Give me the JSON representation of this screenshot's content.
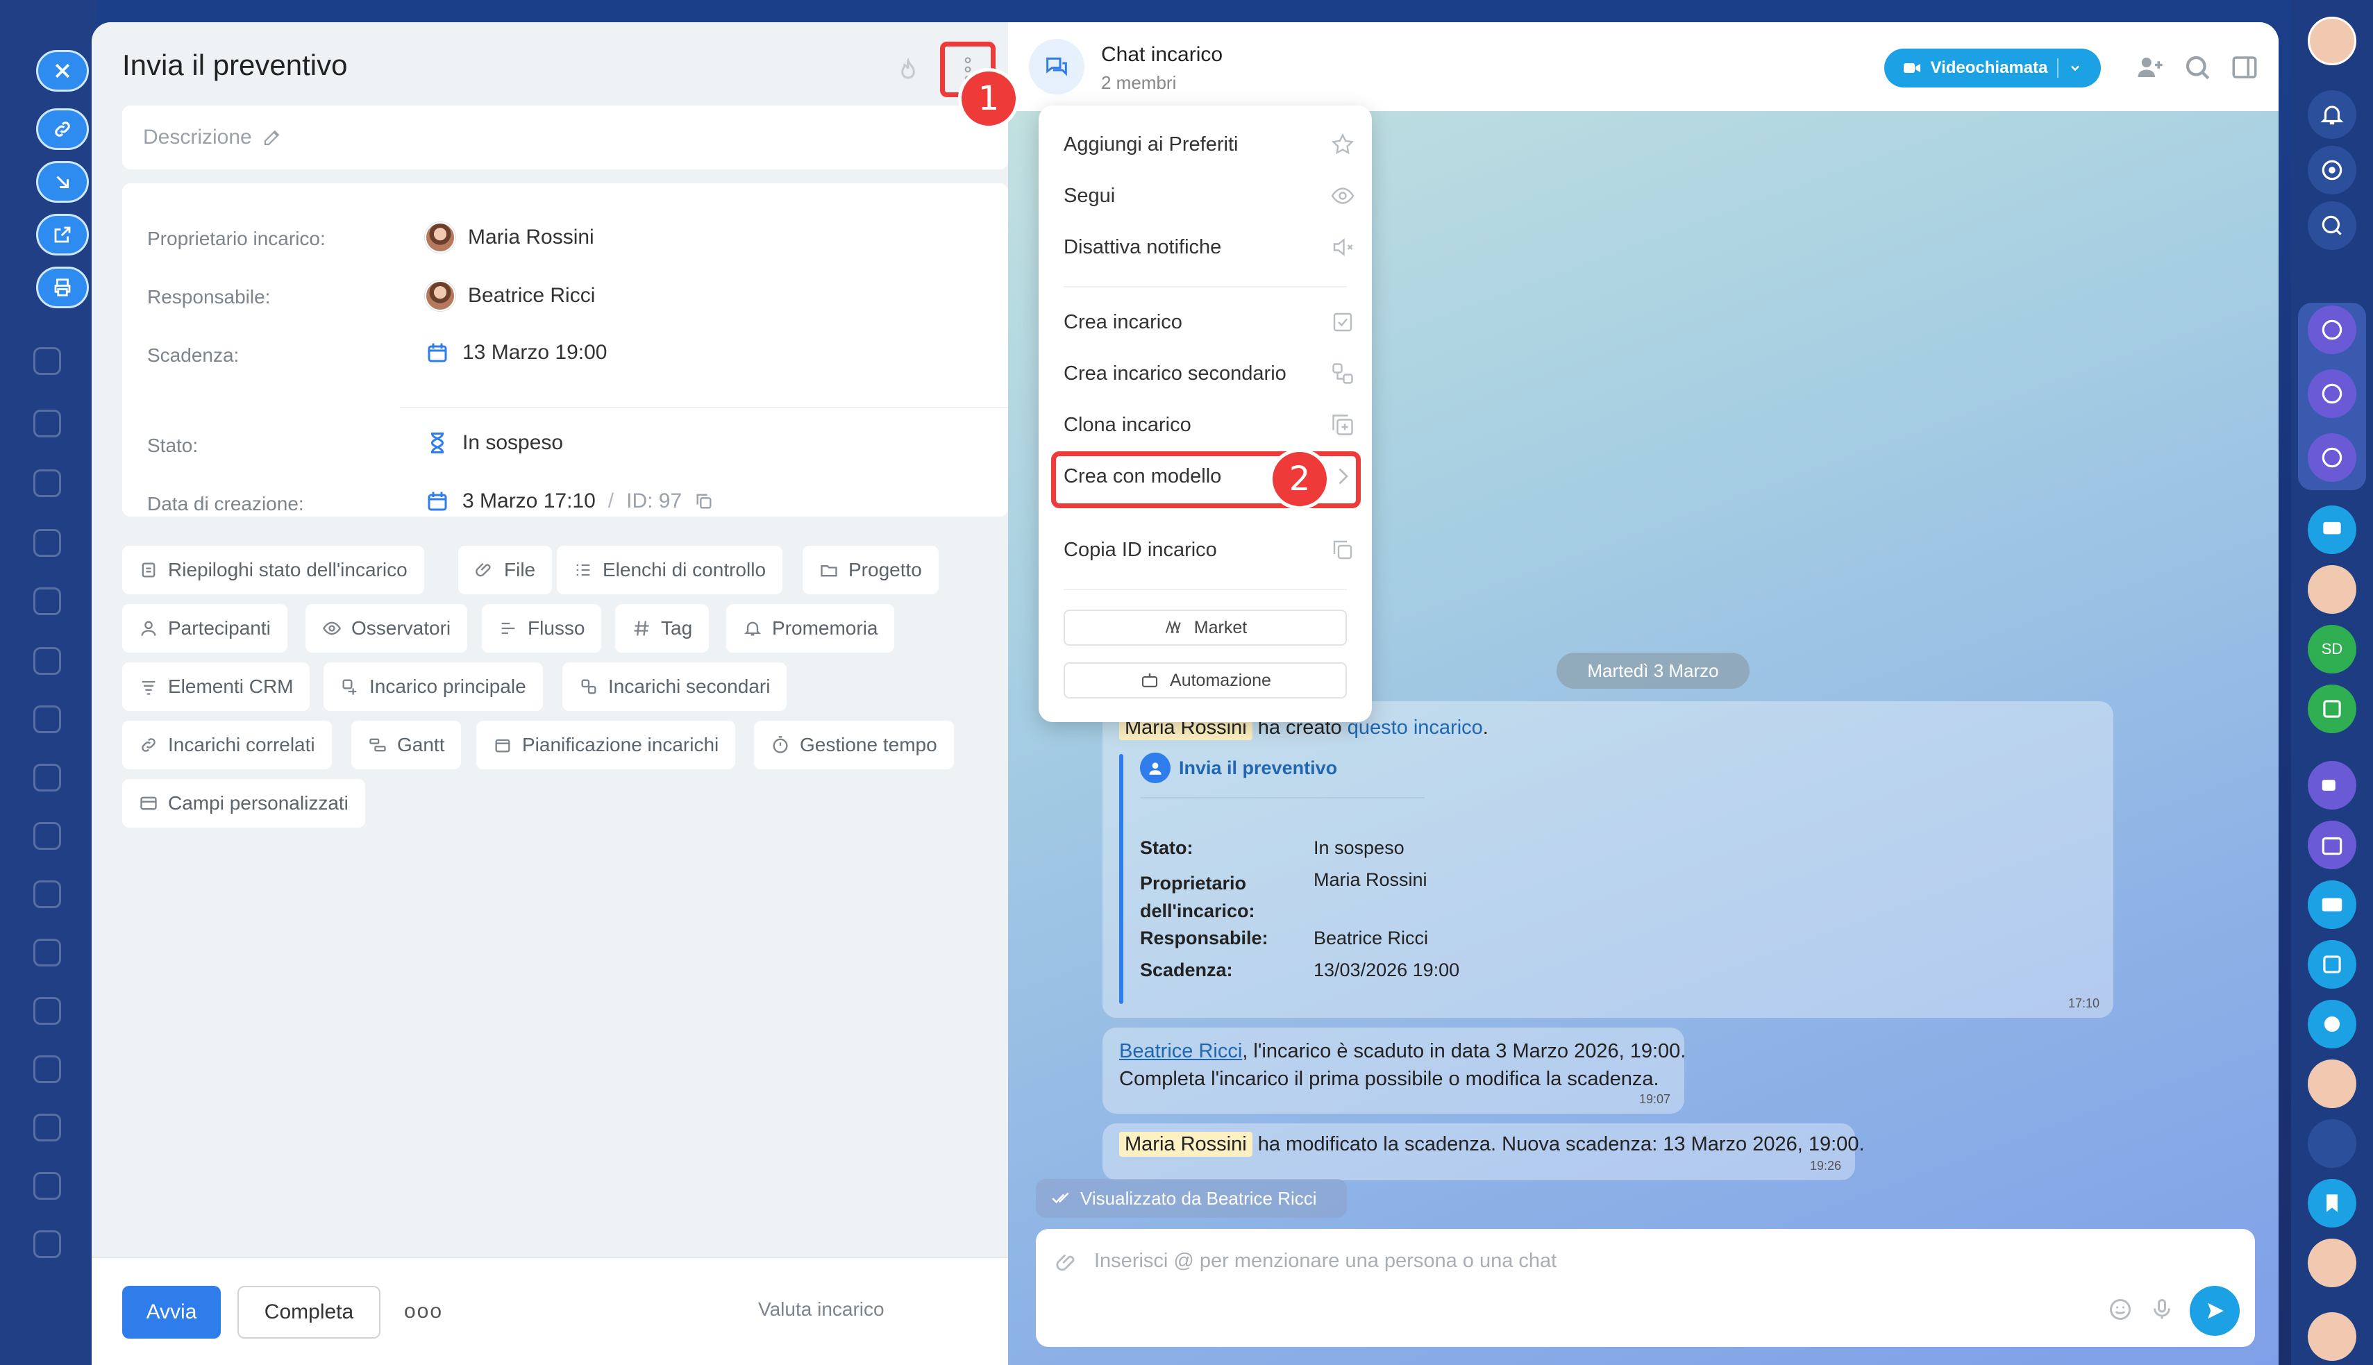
{
  "task": {
    "title": "Invia il preventivo",
    "description_placeholder": "Descrizione",
    "props": [
      {
        "label": "Proprietario incarico:",
        "value": "Maria Rossini"
      },
      {
        "label": "Responsabile:",
        "value": "Beatrice Ricci"
      },
      {
        "label": "Scadenza:",
        "value": "13 Marzo 19:00"
      },
      {
        "label": "Stato:",
        "value": "In sospeso"
      },
      {
        "label": "Data di creazione:",
        "value": "3 Marzo 17:10",
        "id": "ID: 97"
      }
    ],
    "chips": [
      "Riepiloghi stato dell'incarico",
      "File",
      "Elenchi di controllo",
      "Progetto",
      "Partecipanti",
      "Osservatori",
      "Flusso",
      "Tag",
      "Promemoria",
      "Elementi CRM",
      "Incarico principale",
      "Incarichi secondari",
      "Incarichi correlati",
      "Gantt",
      "Pianificazione incarichi",
      "Gestione tempo",
      "Campi personalizzati"
    ],
    "footer": {
      "start": "Avvia",
      "complete": "Completa",
      "more": "ooo",
      "rate": "Valuta incarico"
    }
  },
  "menu": {
    "items": [
      "Aggiungi ai Preferiti",
      "Segui",
      "Disattiva notifiche",
      "Crea incarico",
      "Crea incarico secondario",
      "Clona incarico",
      "Crea con modello",
      "Copia ID incarico"
    ],
    "buttons": [
      "Market",
      "Automazione"
    ]
  },
  "badges": [
    "1",
    "2"
  ],
  "chat": {
    "title": "Chat incarico",
    "subtitle": "2 membri",
    "video_button": "Videochiamata",
    "date_pill": "Martedì 3 Marzo",
    "msg1": {
      "author": "Maria Rossini",
      "text": "ha creato",
      "link": "questo incarico",
      "end": ".",
      "card_title": "Invia il preventivo",
      "rows": [
        {
          "k": "Stato:",
          "v": "In sospeso"
        },
        {
          "k": "Proprietario dell'incarico:",
          "v": "Maria Rossini"
        },
        {
          "k": "Responsabile:",
          "v": "Beatrice Ricci"
        },
        {
          "k": "Scadenza:",
          "v": "13/03/2026 19:00"
        }
      ],
      "time": "17:10"
    },
    "msg2": {
      "author": "Beatrice Ricci",
      "line1": ", l'incarico è scaduto in data 3 Marzo 2026, 19:00.",
      "line2": "Completa l'incarico il prima possibile o modifica la scadenza.",
      "time": "19:07"
    },
    "msg3": {
      "author": "Maria Rossini",
      "text": "ha modificato la scadenza. Nuova scadenza: 13 Marzo 2026, 19:00.",
      "time": "19:26"
    },
    "seen": "Visualizzato da Beatrice Ricci",
    "input_placeholder": "Inserisci @ per menzionare una persona o una chat"
  },
  "colors": {
    "accent": "#2e7deb",
    "highlight": "#ef3a3a",
    "video": "#1ca2e4"
  }
}
